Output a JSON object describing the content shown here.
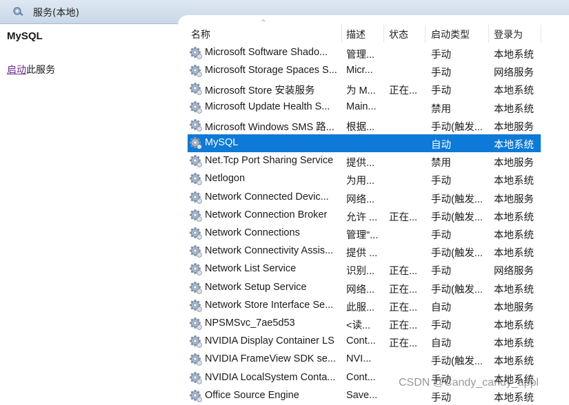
{
  "window": {
    "title": "服务(本地)"
  },
  "left_pane": {
    "service_name": "MySQL",
    "action_link": "启动",
    "action_suffix": "此服务"
  },
  "columns": [
    "名称",
    "描述",
    "状态",
    "启动类型",
    "登录为"
  ],
  "rows": [
    {
      "name": "Microsoft Software Shado...",
      "desc": "管理...",
      "status": "",
      "startup": "手动",
      "logon": "本地系统"
    },
    {
      "name": "Microsoft Storage Spaces S...",
      "desc": "Micr...",
      "status": "",
      "startup": "手动",
      "logon": "网络服务"
    },
    {
      "name": "Microsoft Store 安装服务",
      "desc": "为 M...",
      "status": "正在...",
      "startup": "手动",
      "logon": "本地系统"
    },
    {
      "name": "Microsoft Update Health S...",
      "desc": "Main...",
      "status": "",
      "startup": "禁用",
      "logon": "本地系统"
    },
    {
      "name": "Microsoft Windows SMS 路...",
      "desc": "根据...",
      "status": "",
      "startup": "手动(触发...",
      "logon": "本地服务"
    },
    {
      "name": "MySQL",
      "desc": "",
      "status": "",
      "startup": "自动",
      "logon": "本地系统",
      "selected": true
    },
    {
      "name": "Net.Tcp Port Sharing Service",
      "desc": "提供...",
      "status": "",
      "startup": "禁用",
      "logon": "本地服务"
    },
    {
      "name": "Netlogon",
      "desc": "为用...",
      "status": "",
      "startup": "手动",
      "logon": "本地系统"
    },
    {
      "name": "Network Connected Devic...",
      "desc": "网络...",
      "status": "",
      "startup": "手动(触发...",
      "logon": "本地服务"
    },
    {
      "name": "Network Connection Broker",
      "desc": "允许 ...",
      "status": "正在...",
      "startup": "手动(触发...",
      "logon": "本地系统"
    },
    {
      "name": "Network Connections",
      "desc": "管理\"...",
      "status": "",
      "startup": "手动",
      "logon": "本地系统"
    },
    {
      "name": "Network Connectivity Assis...",
      "desc": "提供 ...",
      "status": "",
      "startup": "手动(触发...",
      "logon": "本地系统"
    },
    {
      "name": "Network List Service",
      "desc": "识别...",
      "status": "正在...",
      "startup": "手动",
      "logon": "网络服务"
    },
    {
      "name": "Network Setup Service",
      "desc": "网络...",
      "status": "正在...",
      "startup": "手动(触发...",
      "logon": "本地系统"
    },
    {
      "name": "Network Store Interface Se...",
      "desc": "此服...",
      "status": "正在...",
      "startup": "自动",
      "logon": "本地服务"
    },
    {
      "name": "NPSMSvc_7ae5d53",
      "desc": "<读...",
      "status": "正在...",
      "startup": "手动",
      "logon": "本地系统"
    },
    {
      "name": "NVIDIA Display Container LS",
      "desc": "Cont...",
      "status": "正在...",
      "startup": "自动",
      "logon": "本地系统"
    },
    {
      "name": "NVIDIA FrameView SDK se...",
      "desc": "NVI...",
      "status": "",
      "startup": "手动(触发...",
      "logon": "本地系统"
    },
    {
      "name": "NVIDIA LocalSystem Conta...",
      "desc": "Cont...",
      "status": "",
      "startup": "手动",
      "logon": "本地系统"
    },
    {
      "name": "Office Source Engine",
      "desc": "Save...",
      "status": "",
      "startup": "手动",
      "logon": "本地系统"
    }
  ],
  "watermark": "CSDN @Candy_candy_appl",
  "colors": {
    "selection": "#0c7ad6",
    "titlebar": "#c9d7e8",
    "link": "#6a2a8a"
  },
  "icons": {
    "title": "services-icon",
    "row": "gear-icon"
  }
}
